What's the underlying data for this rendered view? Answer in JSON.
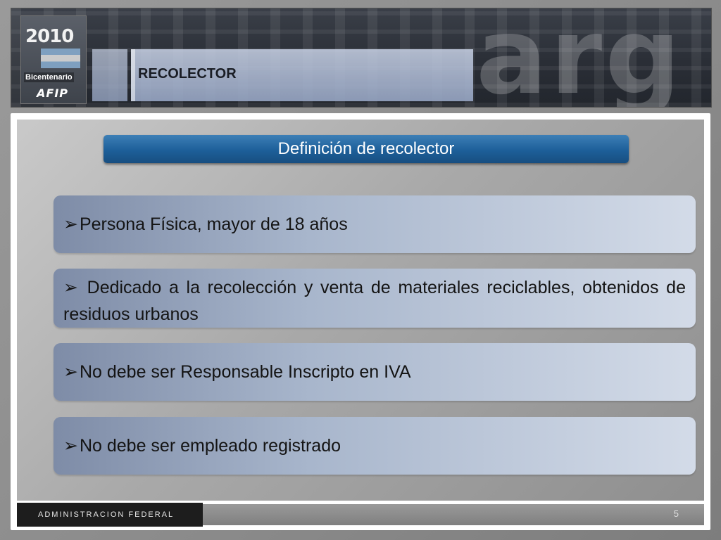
{
  "header": {
    "logo_year": "2010",
    "logo_subtitle": "Bicentenario",
    "logo_brand": "AFIP",
    "watermark": "arg",
    "title": "RECOLECTOR"
  },
  "definition_title": "Definición de recolector",
  "items": [
    {
      "arrow": "➢",
      "text": "Persona Física, mayor de 18 años"
    },
    {
      "arrow": "➢",
      "text": " Dedicado a la recolección y venta de materiales reciclables, obtenidos de residuos urbanos"
    },
    {
      "arrow": "➢",
      "text": "No debe ser Responsable Inscripto en IVA"
    },
    {
      "arrow": "➢",
      "text": "No debe ser empleado registrado"
    }
  ],
  "footer": {
    "label": "ADMINISTRACION FEDERAL",
    "page_number": "5"
  },
  "colors": {
    "title_bar": "#1d5f99",
    "item_gradient_start": "#7e8ca7",
    "item_gradient_end": "#d3dbe8",
    "footer_label_bg": "#1d1d1d"
  }
}
